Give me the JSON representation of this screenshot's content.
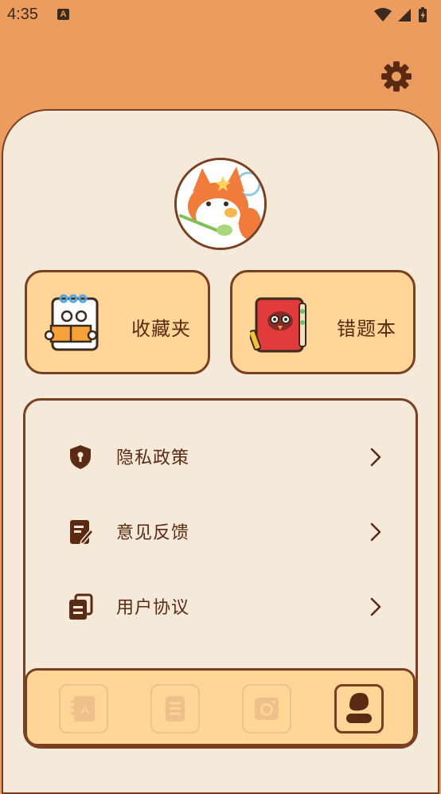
{
  "status_bar": {
    "time": "4:35",
    "notification_glyph": "A"
  },
  "header": {
    "settings_icon": "gear-icon"
  },
  "profile": {
    "avatar": "fox-avatar"
  },
  "quick_cards": [
    {
      "label": "收藏夹",
      "icon": "notebook-reading-icon"
    },
    {
      "label": "错题本",
      "icon": "red-book-owl-icon"
    }
  ],
  "menu": {
    "items": [
      {
        "label": "隐私政策",
        "icon": "shield-lock-icon"
      },
      {
        "label": "意见反馈",
        "icon": "edit-document-icon"
      },
      {
        "label": "用户协议",
        "icon": "documents-icon"
      }
    ]
  },
  "bottom_nav": {
    "tabs": [
      {
        "icon": "vocabulary-book-icon",
        "glyph": "A",
        "active": false
      },
      {
        "icon": "list-document-icon",
        "active": false
      },
      {
        "icon": "camera-icon",
        "active": false
      },
      {
        "icon": "profile-icon",
        "active": true
      }
    ]
  },
  "colors": {
    "header_bg": "#EB9C5E",
    "panel_bg": "#F5EAD9",
    "card_bg": "#FFD697",
    "border": "#7A3E20",
    "text": "#5A2A12"
  }
}
